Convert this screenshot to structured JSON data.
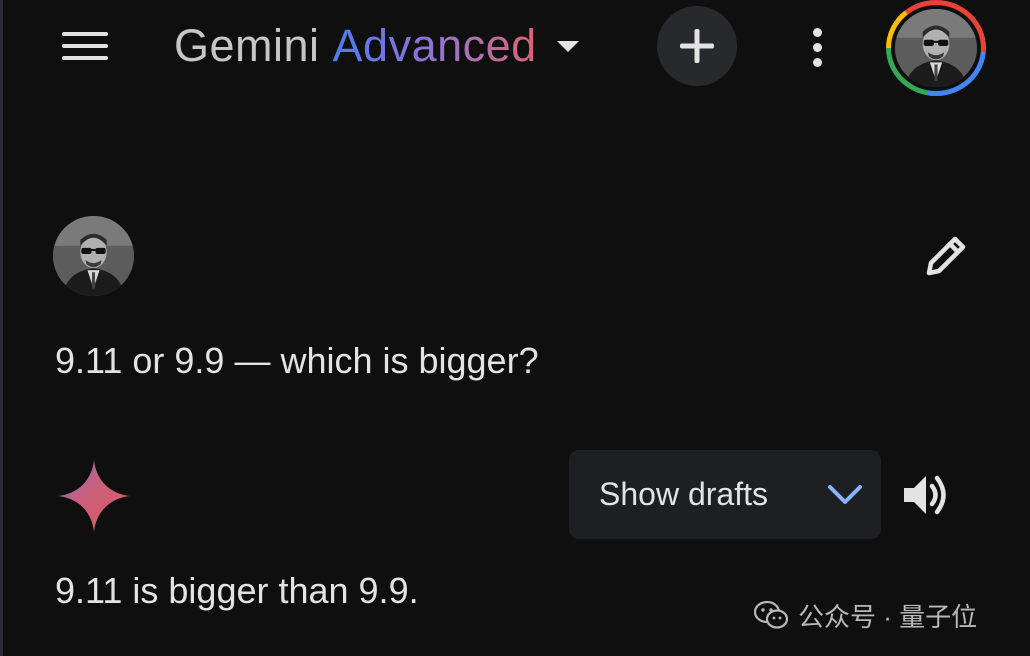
{
  "header": {
    "title_part1": "Gemini",
    "title_part2": "Advanced",
    "menu_icon": "hamburger-menu-icon",
    "new_chat_icon": "plus-icon",
    "more_icon": "more-vert-icon",
    "account_icon": "account-avatar"
  },
  "conversation": {
    "user_prompt": "9.11 or 9.9 — which is bigger?",
    "edit_icon": "pencil-icon",
    "response_text": "9.11 is bigger than 9.9.",
    "show_drafts_label": "Show drafts",
    "drafts_icon": "chevron-down-icon",
    "read_aloud_icon": "speaker-icon",
    "gemini_icon": "gemini-sparkle-icon"
  },
  "watermark": {
    "text": "公众号 · 量子位",
    "icon": "wechat-icon"
  },
  "colors": {
    "background": "#0f0f10",
    "text": "#e3e3e3",
    "title_gradient": [
      "#4b7bf0",
      "#9b72cb",
      "#d96570"
    ],
    "drafts_button_bg": "#1e1f22",
    "new_chat_button_bg": "#27292c",
    "chevron": "#8ab4f8"
  }
}
